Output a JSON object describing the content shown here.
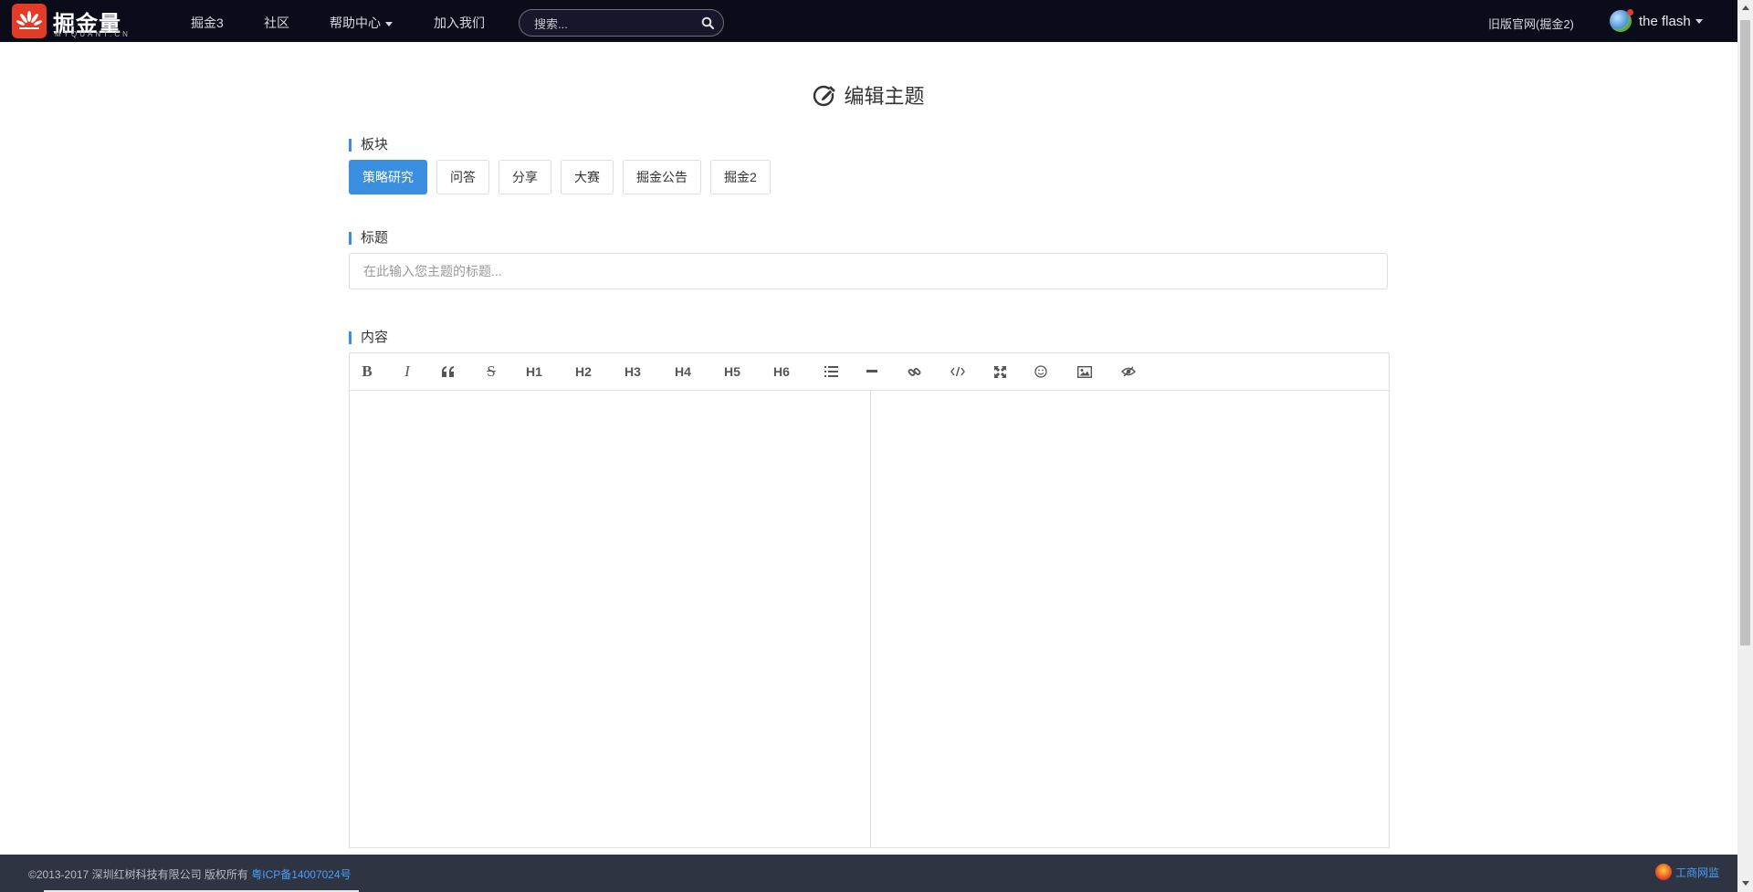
{
  "nav": {
    "logo_text": "掘金量化",
    "logo_sub": "MYQUANT.CN",
    "items": [
      "掘金3",
      "社区",
      "帮助中心",
      "加入我们"
    ],
    "search_placeholder": "搜索...",
    "old_site": "旧版官网(掘金2)",
    "user_name": "the flash"
  },
  "page": {
    "title": "编辑主题",
    "board_label": "板块",
    "boards": [
      "策略研究",
      "问答",
      "分享",
      "大赛",
      "掘金公告",
      "掘金2"
    ],
    "active_board": "策略研究",
    "title_label": "标题",
    "title_placeholder": "在此输入您主题的标题...",
    "content_label": "内容"
  },
  "toolbar": {
    "bold": "B",
    "italic": "I",
    "strike": "S",
    "h1": "H1",
    "h2": "H2",
    "h3": "H3",
    "h4": "H4",
    "h5": "H5",
    "h6": "H6",
    "icons": [
      "bold-icon",
      "italic-icon",
      "quote-icon",
      "strikethrough-icon",
      "h1",
      "h2",
      "h3",
      "h4",
      "h5",
      "h6",
      "list-icon",
      "hr-icon",
      "link-icon",
      "code-icon",
      "fullscreen-icon",
      "emoji-icon",
      "image-icon",
      "preview-toggle-icon"
    ]
  },
  "footer": {
    "copyright": "©2013-2017 深圳红树科技有限公司 版权所有",
    "icp": "粤ICP备14007024号",
    "gongshang": "工商网监"
  },
  "colors": {
    "accent": "#3b8fe0",
    "nav_bg": "#0b0c1a",
    "footer_bg": "#2e3442"
  }
}
